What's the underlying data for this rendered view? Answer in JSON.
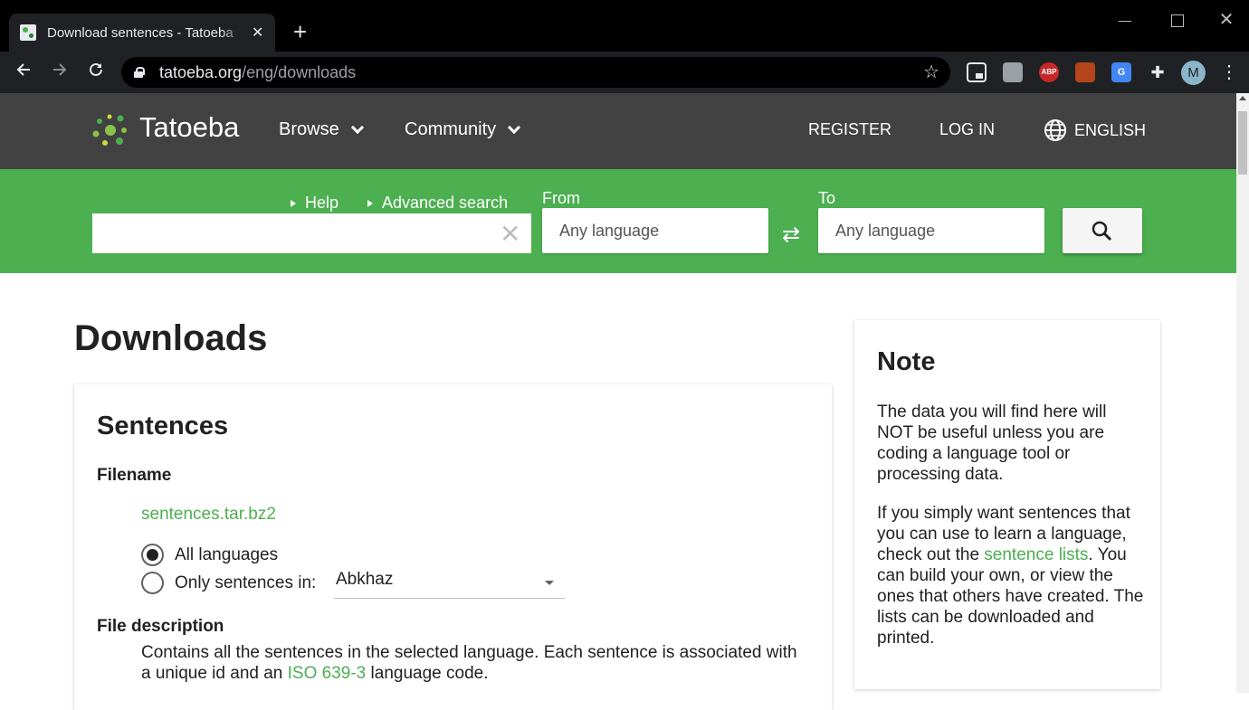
{
  "browser": {
    "tab_title": "Download sentences - Tatoeba",
    "close_glyph": "✕",
    "new_tab_glyph": "+",
    "url_host": "tatoeba.org",
    "url_path": "/eng/downloads",
    "avatar_letter": "M",
    "ext_abp": "ABP",
    "ext_translate": "G",
    "icons": [
      "back-arrow-icon",
      "forward-arrow-icon",
      "reload-icon",
      "lock-icon",
      "star-icon",
      "extension-puzzle-icon",
      "more-vert-icon"
    ]
  },
  "header": {
    "logo": "Tatoeba",
    "nav_browse": "Browse",
    "nav_community": "Community",
    "register": "REGISTER",
    "login": "LOG IN",
    "language": "ENGLISH"
  },
  "search": {
    "help": "Help",
    "advanced": "Advanced search",
    "query": "",
    "from_label": "From",
    "to_label": "To",
    "from_value": "Any language",
    "to_value": "Any language"
  },
  "main": {
    "title": "Downloads",
    "section_title": "Sentences",
    "filename_label": "Filename",
    "filename": "sentences.tar.bz2",
    "radio_all": "All languages",
    "radio_only": "Only sentences in:",
    "language_select": "Abkhaz",
    "desc_label": "File description",
    "desc_part1": "Contains all the sentences in the selected language. Each sentence is associated with a unique id and an ",
    "desc_link": "ISO 639-3",
    "desc_part2": " language code."
  },
  "note": {
    "title": "Note",
    "p1": "The data you will find here will NOT be useful unless you are coding a language tool or processing data.",
    "p2_part1": "If you simply want sentences that you can use to learn a language, check out the ",
    "p2_link": "sentence lists",
    "p2_part2": ". You can build your own, or view the ones that others have created. The lists can be downloaded and printed."
  },
  "colors": {
    "brand_green": "#4caf50",
    "header_gray": "#424242",
    "chrome_dark": "#202124"
  }
}
